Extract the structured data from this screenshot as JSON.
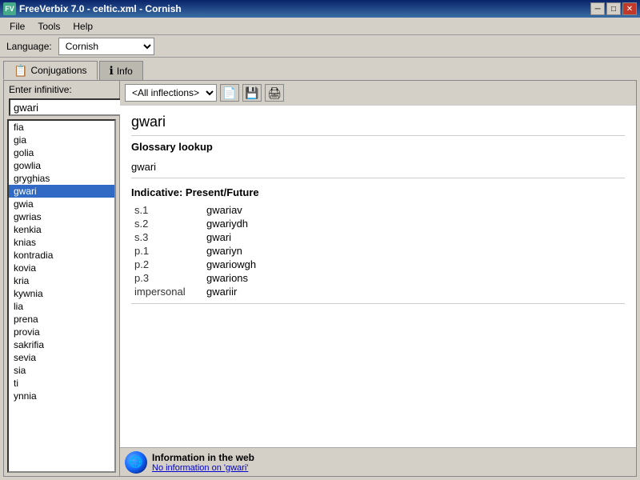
{
  "titleBar": {
    "icon": "FV",
    "title": "FreeVerbix 7.0 - celtic.xml - Cornish",
    "minimize": "─",
    "maximize": "□",
    "close": "✕"
  },
  "menu": {
    "items": [
      "File",
      "Tools",
      "Help"
    ]
  },
  "language": {
    "label": "Language:",
    "current": "Cornish",
    "options": [
      "Cornish"
    ]
  },
  "tabs": [
    {
      "id": "conjugations",
      "label": "Conjugations",
      "icon": "📋",
      "active": true
    },
    {
      "id": "info",
      "label": "Info",
      "icon": "ℹ",
      "active": false
    }
  ],
  "leftPanel": {
    "infinitiveLabel": "Enter infinitive:",
    "inputValue": "gwari",
    "goButtonLabel": "▶",
    "words": [
      "fia",
      "gia",
      "golia",
      "gowlia",
      "gryghias",
      "gwari",
      "gwia",
      "gwrias",
      "kenkia",
      "knias",
      "kontradia",
      "kovia",
      "kria",
      "kywnia",
      "lia",
      "prena",
      "provia",
      "sakrifia",
      "sevia",
      "sia",
      "ti",
      "ynnia"
    ],
    "selectedWord": "gwari"
  },
  "rightPanel": {
    "inflectionSelect": "<All inflections>",
    "inflectionOptions": [
      "<All inflections>"
    ],
    "toolbarButtons": [
      "📄",
      "💾",
      "🖨"
    ],
    "verbTitle": "gwari",
    "glossaryHeading": "Glossary lookup",
    "glossaryValue": "gwari",
    "indicativeHeading": "Indicative: Present/Future",
    "conjugations": [
      {
        "person": "s.1",
        "form": "gwariav"
      },
      {
        "person": "s.2",
        "form": "gwariydh"
      },
      {
        "person": "s.3",
        "form": "gwari"
      },
      {
        "person": "p.1",
        "form": "gwariyn"
      },
      {
        "person": "p.2",
        "form": "gwariowgh"
      },
      {
        "person": "p.3",
        "form": "gwarions"
      },
      {
        "person": "impersonal",
        "form": "gwariir"
      }
    ]
  },
  "webInfo": {
    "title": "Information in the web",
    "linkText": "No information on 'gwari'"
  }
}
